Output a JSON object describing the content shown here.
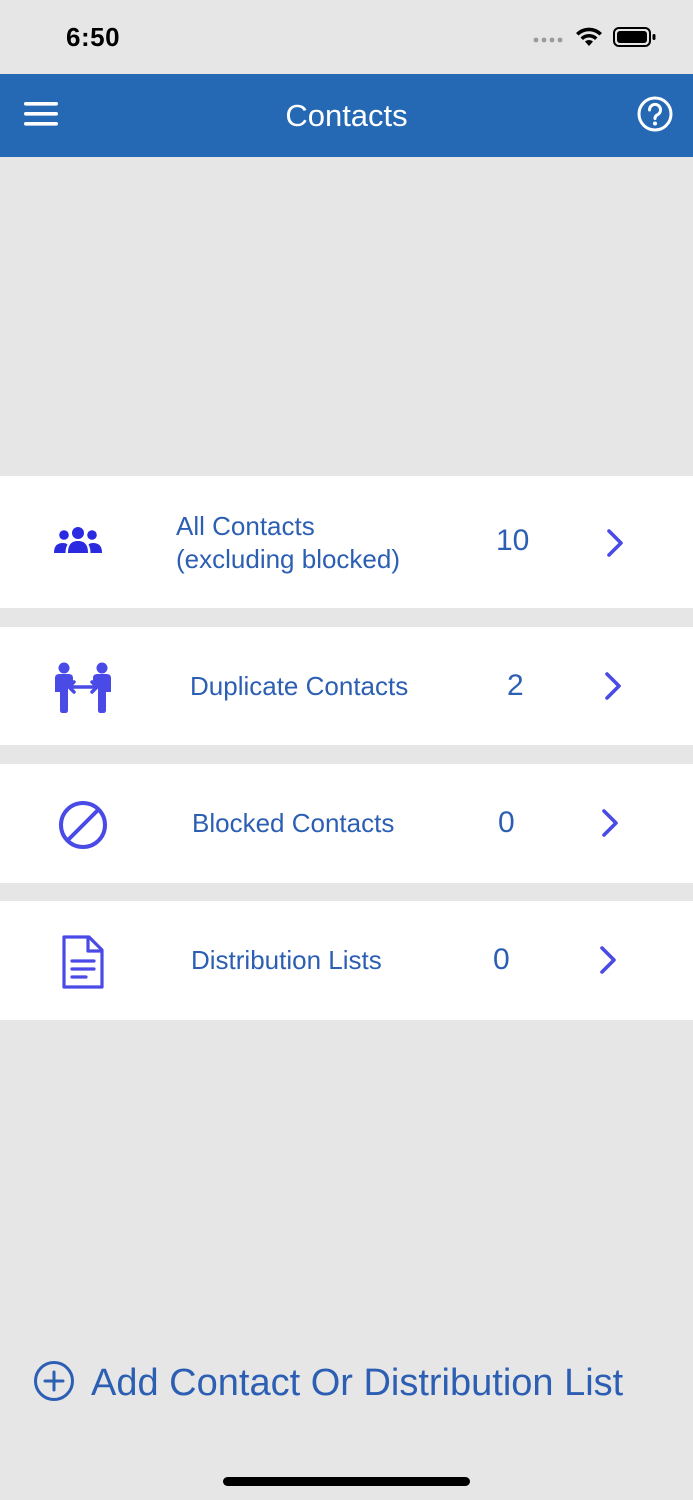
{
  "status_bar": {
    "time": "6:50"
  },
  "header": {
    "title": "Contacts",
    "menu_icon": "hamburger-menu-icon",
    "help_icon": "help-circle-icon",
    "background_color": "#2569b5"
  },
  "rows": [
    {
      "icon": "group-people-icon",
      "label_line1": "All Contacts",
      "label_line2": "(excluding blocked)",
      "count": "10"
    },
    {
      "icon": "duplicate-people-icon",
      "label": "Duplicate Contacts",
      "count": "2"
    },
    {
      "icon": "blocked-icon",
      "label": "Blocked Contacts",
      "count": "0"
    },
    {
      "icon": "document-list-icon",
      "label": "Distribution Lists",
      "count": "0"
    }
  ],
  "add_action": {
    "label": "Add Contact Or Distribution List",
    "icon": "add-circle-icon"
  },
  "colors": {
    "accent_text": "#2c5fb3",
    "icon_blue": "#4a4ae6",
    "background": "#e6e6e6"
  }
}
